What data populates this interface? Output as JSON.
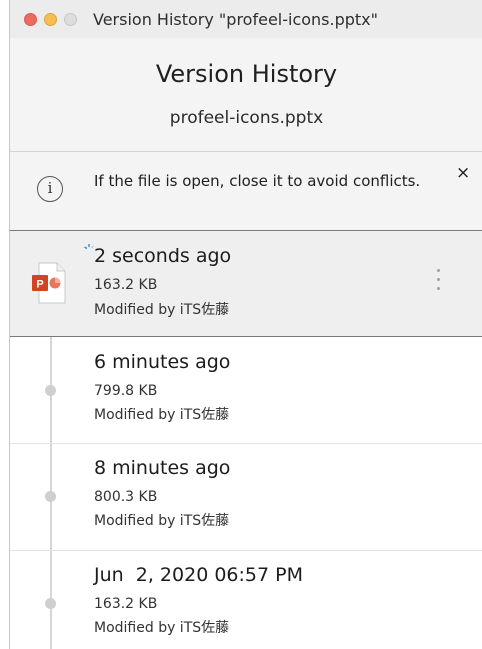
{
  "window": {
    "title": "Version History \"profeel-icons.pptx\""
  },
  "header": {
    "title": "Version History",
    "filename": "profeel-icons.pptx"
  },
  "notice": {
    "text": "If the file is open, close it to avoid conflicts.",
    "close_label": "×"
  },
  "versions": [
    {
      "time": "2 seconds ago",
      "size": "163.2 KB",
      "modified_by": "Modified by iTS佐藤",
      "selected": true
    },
    {
      "time": "6 minutes ago",
      "size": "799.8 KB",
      "modified_by": "Modified by iTS佐藤"
    },
    {
      "time": "8 minutes ago",
      "size": "800.3 KB",
      "modified_by": "Modified by iTS佐藤"
    },
    {
      "time": "Jun  2, 2020 06:57 PM",
      "size": "163.2 KB",
      "modified_by": "Modified by iTS佐藤"
    }
  ],
  "colors": {
    "close_light": "#ed6a5e",
    "minimize_light": "#f5bf4f",
    "zoom_light": "#dddddd",
    "powerpoint_accent": "#d04423",
    "spinner_accent": "#2e8bd6"
  }
}
